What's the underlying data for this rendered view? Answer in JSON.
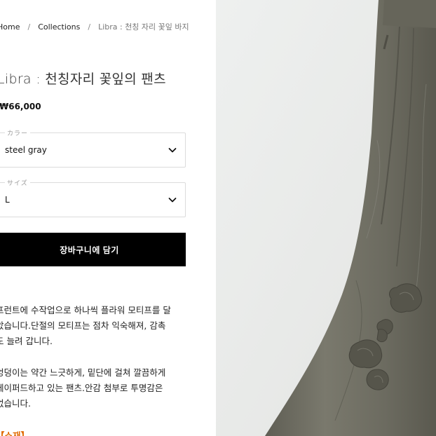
{
  "breadcrumb": {
    "items": [
      "Home",
      "Collections"
    ],
    "current": "Libra : 천칭 자리 꽃잎 바지",
    "separator": "/"
  },
  "product": {
    "title": "Libra : 천칭자리 꽃잎의 팬츠",
    "price": "₩66,000"
  },
  "options": {
    "color": {
      "label": "カラー",
      "value": "steel gray"
    },
    "size": {
      "label": "サイズ",
      "value": "L"
    }
  },
  "cart_button": {
    "label": "장바구니에 담기"
  },
  "description": {
    "paragraph1": [
      "프런트에 수작업으로 하나씩 플라워 모티프를 달",
      "았습니다.단절의 모티프는 점차 익숙해져, 감촉",
      "도 늘려 갑니다."
    ],
    "paragraph2": [
      "엉덩이는 약간 느긋하게, 밑단에 걸쳐 깔끔하게",
      "테이퍼드하고 있는 팬츠.안감 첨부로 투명감은",
      "없습니다."
    ],
    "material_heading": "【소재】"
  },
  "icons": {
    "chevron": "chevron-down-icon"
  },
  "colors": {
    "button_bg": "#000000",
    "pants": "#6f6e63",
    "photo_bg": "#ecedec"
  }
}
